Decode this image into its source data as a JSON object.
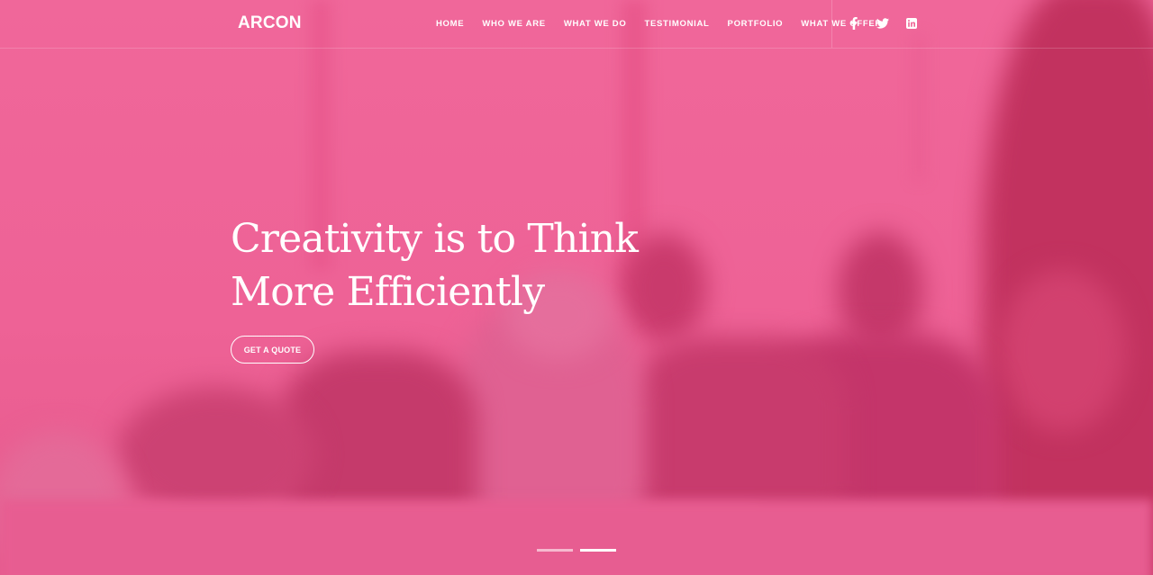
{
  "header": {
    "logo": "ARCON",
    "nav": [
      "HOME",
      "WHO WE ARE",
      "WHAT WE DO",
      "TESTIMONIAL",
      "PORTFOLIO",
      "WHAT WE OFFER"
    ],
    "social": [
      "facebook-icon",
      "twitter-icon",
      "linkedin-icon"
    ]
  },
  "hero": {
    "title_line1": "Creativity is to Think",
    "title_line2": "More Efficiently",
    "cta_label": "GET A QUOTE",
    "slides": 2,
    "active_slide": 2
  },
  "colors": {
    "overlay": "#ee6395",
    "text": "#ffffff",
    "dot_inactive": "#f6b9cf",
    "dot_active": "#ffffff"
  }
}
